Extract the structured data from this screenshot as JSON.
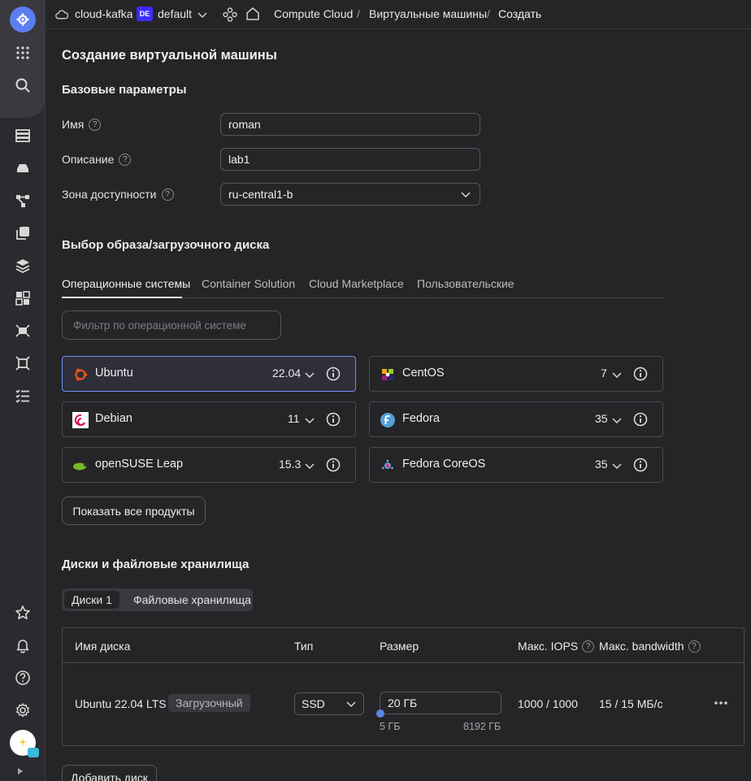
{
  "topbar": {
    "cloud_name": "cloud-kafka",
    "folder_badge": "DE",
    "folder_name": "default",
    "breadcrumb": [
      "Compute Cloud",
      "Виртуальные машины",
      "Создать"
    ],
    "separator": "/"
  },
  "page": {
    "title": "Создание виртуальной машины"
  },
  "basic": {
    "section_title": "Базовые параметры",
    "name_label": "Имя",
    "name_value": "roman",
    "desc_label": "Описание",
    "desc_value": "lab1",
    "zone_label": "Зона доступности",
    "zone_value": "ru-central1-b",
    "help_glyph": "?"
  },
  "image": {
    "section_title": "Выбор образа/загрузочного диска",
    "tabs": [
      "Операционные системы",
      "Container Solution",
      "Cloud Marketplace",
      "Пользовательские"
    ],
    "filter_placeholder": "Фильтр по операционной системе",
    "os_list": [
      {
        "name": "Ubuntu",
        "version": "22.04",
        "selected": true
      },
      {
        "name": "CentOS",
        "version": "7"
      },
      {
        "name": "Debian",
        "version": "11"
      },
      {
        "name": "Fedora",
        "version": "35"
      },
      {
        "name": "openSUSE Leap",
        "version": "15.3"
      },
      {
        "name": "Fedora CoreOS",
        "version": "35"
      }
    ],
    "show_all_label": "Показать все продукты"
  },
  "disks": {
    "section_title": "Диски и файловые хранилища",
    "seg_disks": "Диски 1",
    "seg_fs": "Файловые хранилища",
    "columns": [
      "Имя диска",
      "Тип",
      "Размер",
      "Макс. IOPS",
      "Макс. bandwidth"
    ],
    "row": {
      "name": "Ubuntu 22.04 LTS",
      "badge": "Загрузочный",
      "type": "SSD",
      "size": "20 ГБ",
      "size_min": "5 ГБ",
      "size_max": "8192 ГБ",
      "iops": "1000 / 1000",
      "bandwidth": "15 / 15 МБ/с"
    },
    "add_disk_label": "Добавить диск"
  },
  "colors": {
    "accent": "#6d8ff0",
    "background": "#252427"
  }
}
